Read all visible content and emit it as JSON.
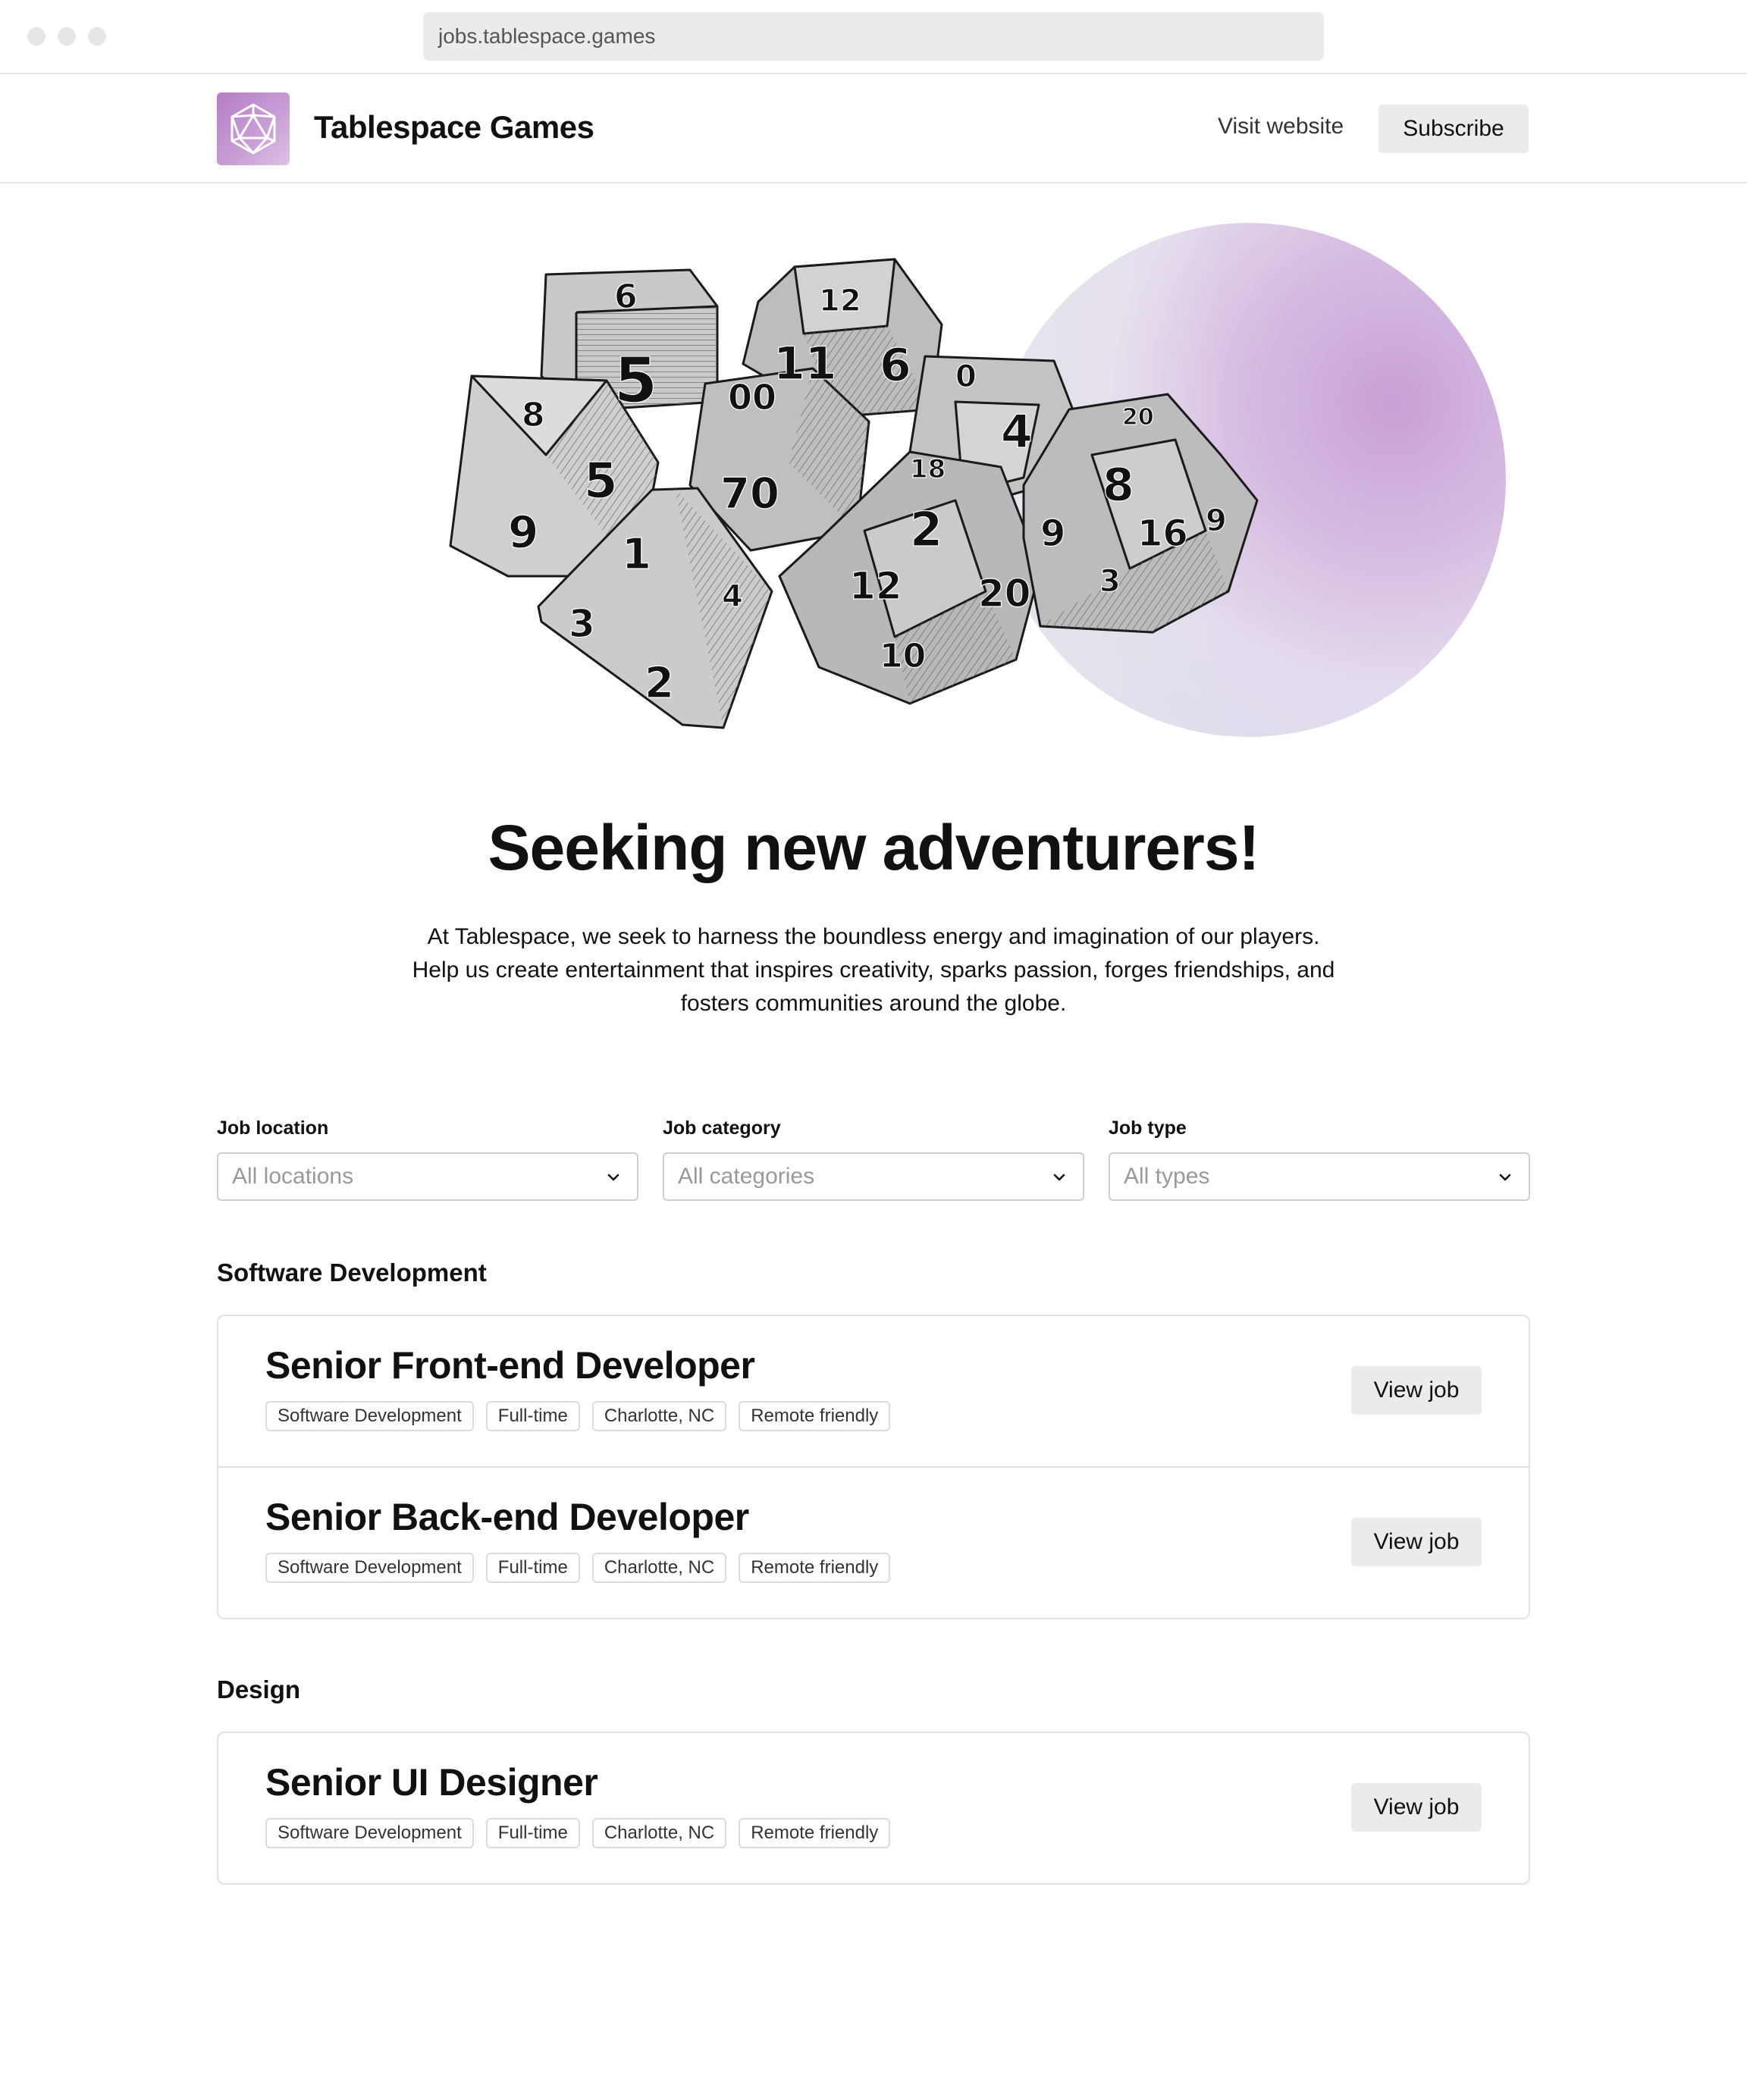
{
  "browser": {
    "url": "jobs.tablespace.games"
  },
  "header": {
    "brand": "Tablespace Games",
    "visit_label": "Visit website",
    "subscribe_label": "Subscribe"
  },
  "hero": {
    "headline": "Seeking new adventurers!",
    "intro": "At Tablespace, we seek to harness the boundless energy and imagination of our players. Help us create entertainment that inspires creativity, sparks passion, forges friendships, and fosters communities around the globe."
  },
  "filters": [
    {
      "label": "Job location",
      "placeholder": "All locations"
    },
    {
      "label": "Job category",
      "placeholder": "All categories"
    },
    {
      "label": "Job type",
      "placeholder": "All types"
    }
  ],
  "sections": [
    {
      "title": "Software Development",
      "jobs": [
        {
          "title": "Senior Front-end Developer",
          "tags": [
            "Software Development",
            "Full-time",
            "Charlotte, NC",
            "Remote friendly"
          ],
          "button": "View job"
        },
        {
          "title": "Senior Back-end Developer",
          "tags": [
            "Software Development",
            "Full-time",
            "Charlotte, NC",
            "Remote friendly"
          ],
          "button": "View job"
        }
      ]
    },
    {
      "title": "Design",
      "jobs": [
        {
          "title": "Senior UI Designer",
          "tags": [
            "Software Development",
            "Full-time",
            "Charlotte, NC",
            "Remote friendly"
          ],
          "button": "View job"
        }
      ]
    }
  ],
  "colors": {
    "brand": "#b67cc6",
    "button_bg": "#ebebeb",
    "border": "#e2e2e2"
  }
}
